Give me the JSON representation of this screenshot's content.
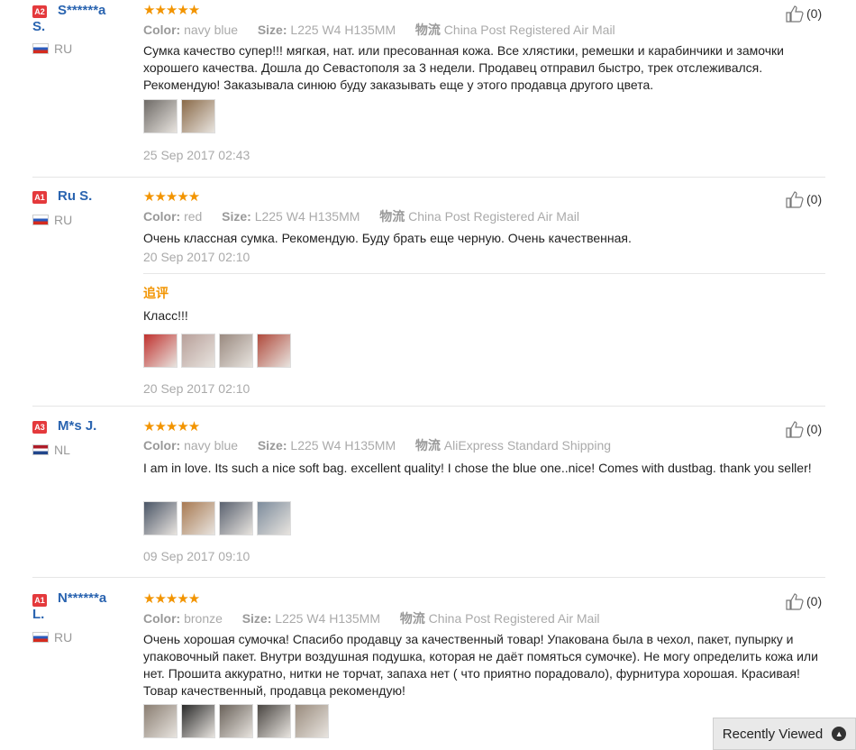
{
  "reviews": [
    {
      "level": "A2",
      "user_line1": "S******a",
      "user_line2": "S.",
      "country": "RU",
      "stars": "★★★★★",
      "color_label": "Color:",
      "color_value": "navy blue",
      "size_label": "Size:",
      "size_value": "L225 W4 H135MM",
      "ship_label": "物流",
      "ship_value": "China Post Registered Air Mail",
      "text": "Сумка качество супер!!! мягкая, нат. или пресованная кожа. Все хлястики, ремешки и карабинчики и замочки хорошего качества. Дошла до Севастополя за 3 недели. Продавец отправил быстро, трек отслеживался. Рекомендую! Заказывала синюю буду заказывать еще у этого продавца другого цвета.",
      "date": "25 Sep 2017 02:43",
      "helpful": "(0)",
      "photo_colors": [
        "#6e6a66",
        "#8a6a48"
      ]
    },
    {
      "level": "A1",
      "user_line1": "Ru S.",
      "user_line2": "",
      "country": "RU",
      "stars": "★★★★★",
      "color_label": "Color:",
      "color_value": "red",
      "size_label": "Size:",
      "size_value": "L225 W4 H135MM",
      "ship_label": "物流",
      "ship_value": "China Post Registered Air Mail",
      "text": "Очень классная сумка. Рекомендую. Буду брать еще черную. Очень качественная.",
      "date": "20 Sep 2017 02:10",
      "helpful": "(0)",
      "additional": {
        "label": "追评",
        "text": "Класс!!!",
        "date": "20 Sep 2017 02:10",
        "photo_colors": [
          "#c0312e",
          "#b8a09a",
          "#9a8a80",
          "#b04a3c"
        ]
      }
    },
    {
      "level": "A3",
      "user_line1": "M*s J.",
      "user_line2": "",
      "country": "NL",
      "stars": "★★★★★",
      "color_label": "Color:",
      "color_value": "navy blue",
      "size_label": "Size:",
      "size_value": "L225 W4 H135MM",
      "ship_label": "物流",
      "ship_value": "AliExpress Standard Shipping",
      "text": "I am in love. Its such a nice soft bag. excellent quality! I chose the blue one..nice! Comes with dustbag. thank you seller!",
      "date": "09 Sep 2017 09:10",
      "helpful": "(0)",
      "photo_colors": [
        "#4a5566",
        "#a87a52",
        "#5a6270",
        "#7d8c9c"
      ]
    },
    {
      "level": "A1",
      "user_line1": "N******a",
      "user_line2": "L.",
      "country": "RU",
      "stars": "★★★★★",
      "color_label": "Color:",
      "color_value": "bronze",
      "size_label": "Size:",
      "size_value": "L225 W4 H135MM",
      "ship_label": "物流",
      "ship_value": "China Post Registered Air Mail",
      "text": "Очень хорошая сумочка! Спасибо продавцу за качественный товар! Упакована была в чехол, пакет, пупырку и упаковочный пакет. Внутри воздушная подушка, которая не даёт помяться сумочке). Не могу определить кожа или нет. Прошита аккуратно, нитки не торчат, запаха нет ( что приятно порадовало), фурнитура хорошая. Красивая! Товар качественный, продавца рекомендую!",
      "helpful": "(0)",
      "photo_colors": [
        "#8a7e72",
        "#2a2a2a",
        "#6a625a",
        "#4a4642",
        "#9a8c7e"
      ]
    }
  ],
  "recently_viewed": {
    "label": "Recently Viewed",
    "icon": "chevron-up-icon"
  }
}
